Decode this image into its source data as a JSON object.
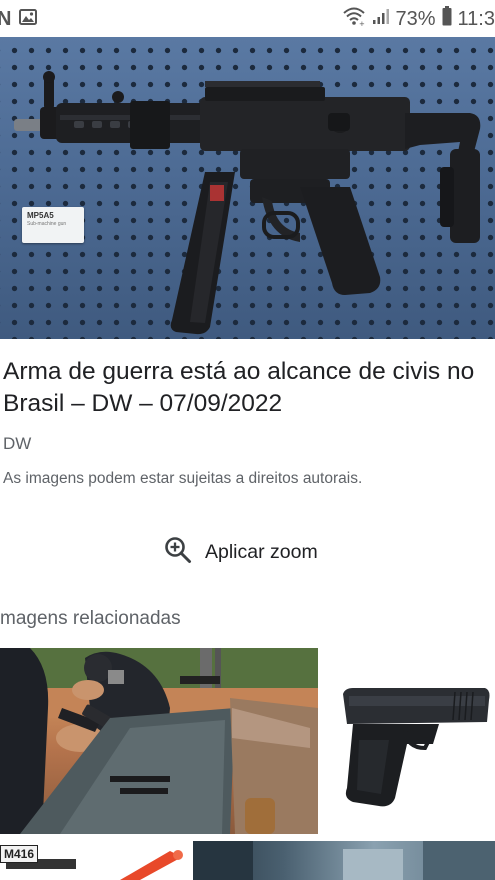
{
  "status_bar": {
    "notification_letter": "N",
    "battery_percent": "73%",
    "time": "11:3",
    "icons": [
      "image-notification-icon",
      "wifi-icon",
      "signal-icon",
      "battery-icon"
    ]
  },
  "hero": {
    "image_description_name": "submachine-gun-on-pegboard",
    "card_label": "MP5A5",
    "card_sub": "Sub-machine gun"
  },
  "result": {
    "title": "Arma de guerra está ao alcance de civis no Brasil – DW – 07/09/2022",
    "source": "DW",
    "copyright_notice": "As imagens podem estar sujeitas a direitos autorais."
  },
  "zoom": {
    "label": "Aplicar zoom",
    "icon": "zoom-in-icon"
  },
  "related": {
    "heading": "magens relacionadas",
    "thumbnails": [
      {
        "name": "police-shooting-range"
      },
      {
        "name": "compact-pistol"
      },
      {
        "name": "m416-toy-rifle",
        "label": "M416"
      },
      {
        "name": "outdoor-scene"
      }
    ]
  },
  "colors": {
    "text_primary": "#202124",
    "text_secondary": "#5f6368",
    "pegboard_blue": "#4f6e98"
  }
}
